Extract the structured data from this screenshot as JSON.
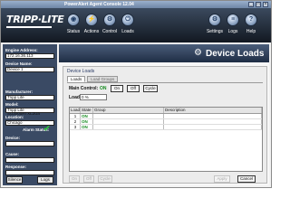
{
  "window": {
    "title": "PowerAlert Agent Console 12.04"
  },
  "brand": {
    "logo_text": "TRIPP·LITE"
  },
  "nav": {
    "left": [
      {
        "label": "Status",
        "icon": "status-icon",
        "glyph": "◉"
      },
      {
        "label": "Actions",
        "icon": "actions-icon",
        "glyph": "⚡"
      },
      {
        "label": "Control",
        "icon": "control-icon",
        "glyph": "⚙"
      },
      {
        "label": "Loads",
        "icon": "loads-icon",
        "glyph": "⏻"
      }
    ],
    "right": [
      {
        "label": "Settings",
        "icon": "settings-icon",
        "glyph": "⚙"
      },
      {
        "label": "Logs",
        "icon": "logs-icon",
        "glyph": "≡"
      },
      {
        "label": "Help",
        "icon": "help-icon",
        "glyph": "?"
      }
    ]
  },
  "sidebar": {
    "engine_address_label": "Engine Address:",
    "engine_address_value": "172.16.36.113",
    "device_name_label": "Device Name:",
    "device_name_value": "Device 1",
    "manufacturer_label": "Manufacturer:",
    "manufacturer_value": "Tripp Lite",
    "model_label": "Model:",
    "model_value": "Tripp Lite SU3000RTXL2Ua",
    "location_label": "Location:",
    "location_value": "Chicago",
    "alarm_status_label": "Alarm Status:",
    "device_label": "Device:",
    "cause_label": "Cause:",
    "response_label": "Response:",
    "silence_button": "Silence",
    "logs_button": "Logs"
  },
  "page": {
    "title": "Device Loads",
    "section_title": "Device Loads",
    "tabs": [
      "Loads",
      "Load Groups"
    ],
    "main_control_label": "Main Control:",
    "main_control_state": "ON",
    "buttons": {
      "on": "On",
      "off": "Off",
      "cycle": "Cycle"
    },
    "load_label": "Load:",
    "load_value": "0 %",
    "table": {
      "columns": [
        "Load",
        "State",
        "Group",
        "Description"
      ],
      "rows": [
        {
          "load": "1",
          "state": "ON",
          "group": "",
          "description": ""
        },
        {
          "load": "2",
          "state": "ON",
          "group": "",
          "description": ""
        },
        {
          "load": "3",
          "state": "ON",
          "group": "",
          "description": ""
        }
      ]
    },
    "bottom_buttons": {
      "on": "On",
      "off": "Off",
      "cycle": "Cycle"
    },
    "apply_button": "Apply",
    "cancel_button": "Cancel"
  }
}
